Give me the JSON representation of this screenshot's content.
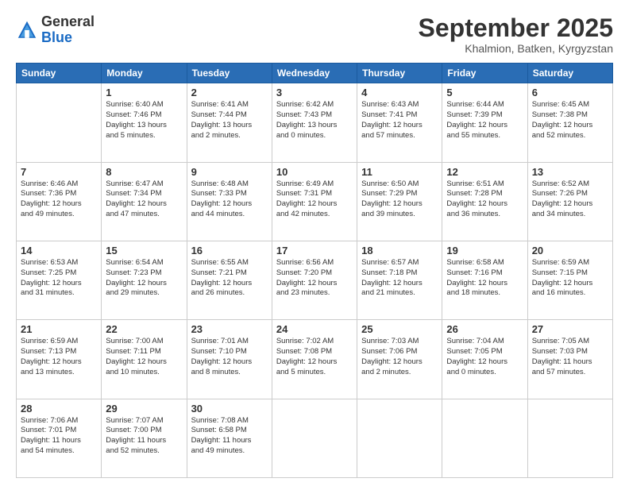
{
  "logo": {
    "general": "General",
    "blue": "Blue"
  },
  "header": {
    "month": "September 2025",
    "location": "Khalmion, Batken, Kyrgyzstan"
  },
  "weekdays": [
    "Sunday",
    "Monday",
    "Tuesday",
    "Wednesday",
    "Thursday",
    "Friday",
    "Saturday"
  ],
  "weeks": [
    [
      {
        "day": "",
        "content": ""
      },
      {
        "day": "1",
        "content": "Sunrise: 6:40 AM\nSunset: 7:46 PM\nDaylight: 13 hours\nand 5 minutes."
      },
      {
        "day": "2",
        "content": "Sunrise: 6:41 AM\nSunset: 7:44 PM\nDaylight: 13 hours\nand 2 minutes."
      },
      {
        "day": "3",
        "content": "Sunrise: 6:42 AM\nSunset: 7:43 PM\nDaylight: 13 hours\nand 0 minutes."
      },
      {
        "day": "4",
        "content": "Sunrise: 6:43 AM\nSunset: 7:41 PM\nDaylight: 12 hours\nand 57 minutes."
      },
      {
        "day": "5",
        "content": "Sunrise: 6:44 AM\nSunset: 7:39 PM\nDaylight: 12 hours\nand 55 minutes."
      },
      {
        "day": "6",
        "content": "Sunrise: 6:45 AM\nSunset: 7:38 PM\nDaylight: 12 hours\nand 52 minutes."
      }
    ],
    [
      {
        "day": "7",
        "content": "Sunrise: 6:46 AM\nSunset: 7:36 PM\nDaylight: 12 hours\nand 49 minutes."
      },
      {
        "day": "8",
        "content": "Sunrise: 6:47 AM\nSunset: 7:34 PM\nDaylight: 12 hours\nand 47 minutes."
      },
      {
        "day": "9",
        "content": "Sunrise: 6:48 AM\nSunset: 7:33 PM\nDaylight: 12 hours\nand 44 minutes."
      },
      {
        "day": "10",
        "content": "Sunrise: 6:49 AM\nSunset: 7:31 PM\nDaylight: 12 hours\nand 42 minutes."
      },
      {
        "day": "11",
        "content": "Sunrise: 6:50 AM\nSunset: 7:29 PM\nDaylight: 12 hours\nand 39 minutes."
      },
      {
        "day": "12",
        "content": "Sunrise: 6:51 AM\nSunset: 7:28 PM\nDaylight: 12 hours\nand 36 minutes."
      },
      {
        "day": "13",
        "content": "Sunrise: 6:52 AM\nSunset: 7:26 PM\nDaylight: 12 hours\nand 34 minutes."
      }
    ],
    [
      {
        "day": "14",
        "content": "Sunrise: 6:53 AM\nSunset: 7:25 PM\nDaylight: 12 hours\nand 31 minutes."
      },
      {
        "day": "15",
        "content": "Sunrise: 6:54 AM\nSunset: 7:23 PM\nDaylight: 12 hours\nand 29 minutes."
      },
      {
        "day": "16",
        "content": "Sunrise: 6:55 AM\nSunset: 7:21 PM\nDaylight: 12 hours\nand 26 minutes."
      },
      {
        "day": "17",
        "content": "Sunrise: 6:56 AM\nSunset: 7:20 PM\nDaylight: 12 hours\nand 23 minutes."
      },
      {
        "day": "18",
        "content": "Sunrise: 6:57 AM\nSunset: 7:18 PM\nDaylight: 12 hours\nand 21 minutes."
      },
      {
        "day": "19",
        "content": "Sunrise: 6:58 AM\nSunset: 7:16 PM\nDaylight: 12 hours\nand 18 minutes."
      },
      {
        "day": "20",
        "content": "Sunrise: 6:59 AM\nSunset: 7:15 PM\nDaylight: 12 hours\nand 16 minutes."
      }
    ],
    [
      {
        "day": "21",
        "content": "Sunrise: 6:59 AM\nSunset: 7:13 PM\nDaylight: 12 hours\nand 13 minutes."
      },
      {
        "day": "22",
        "content": "Sunrise: 7:00 AM\nSunset: 7:11 PM\nDaylight: 12 hours\nand 10 minutes."
      },
      {
        "day": "23",
        "content": "Sunrise: 7:01 AM\nSunset: 7:10 PM\nDaylight: 12 hours\nand 8 minutes."
      },
      {
        "day": "24",
        "content": "Sunrise: 7:02 AM\nSunset: 7:08 PM\nDaylight: 12 hours\nand 5 minutes."
      },
      {
        "day": "25",
        "content": "Sunrise: 7:03 AM\nSunset: 7:06 PM\nDaylight: 12 hours\nand 2 minutes."
      },
      {
        "day": "26",
        "content": "Sunrise: 7:04 AM\nSunset: 7:05 PM\nDaylight: 12 hours\nand 0 minutes."
      },
      {
        "day": "27",
        "content": "Sunrise: 7:05 AM\nSunset: 7:03 PM\nDaylight: 11 hours\nand 57 minutes."
      }
    ],
    [
      {
        "day": "28",
        "content": "Sunrise: 7:06 AM\nSunset: 7:01 PM\nDaylight: 11 hours\nand 54 minutes."
      },
      {
        "day": "29",
        "content": "Sunrise: 7:07 AM\nSunset: 7:00 PM\nDaylight: 11 hours\nand 52 minutes."
      },
      {
        "day": "30",
        "content": "Sunrise: 7:08 AM\nSunset: 6:58 PM\nDaylight: 11 hours\nand 49 minutes."
      },
      {
        "day": "",
        "content": ""
      },
      {
        "day": "",
        "content": ""
      },
      {
        "day": "",
        "content": ""
      },
      {
        "day": "",
        "content": ""
      }
    ]
  ]
}
